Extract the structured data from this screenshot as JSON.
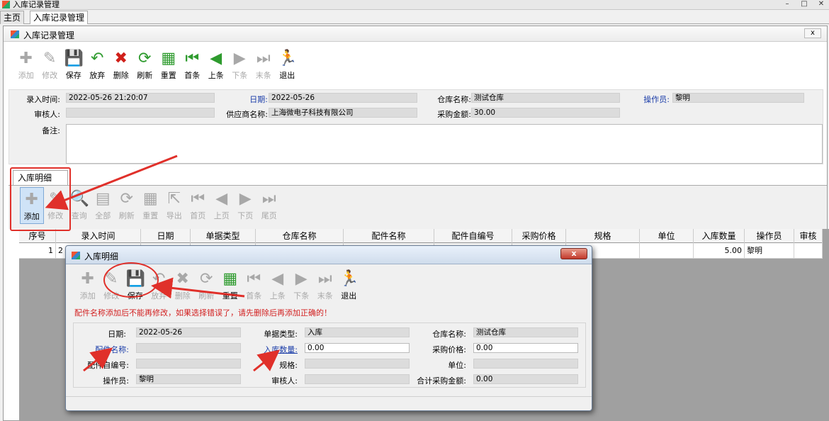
{
  "window": {
    "title": "入库记录管理"
  },
  "top_tabs": [
    {
      "label": "主页"
    },
    {
      "label": "入库记录管理"
    }
  ],
  "inner": {
    "title": "入库记录管理",
    "close_label": "x"
  },
  "main_toolbar": [
    {
      "label": "添加",
      "icon": "plus-icon",
      "glyph": "✚",
      "color": "#a8a8a8",
      "enabled": false
    },
    {
      "label": "修改",
      "icon": "edit-icon",
      "glyph": "✎",
      "color": "#a8a8a8",
      "enabled": false
    },
    {
      "label": "保存",
      "icon": "save-icon",
      "glyph": "💾",
      "color": "#1f5fbf",
      "enabled": true
    },
    {
      "label": "放弃",
      "icon": "undo-icon",
      "glyph": "↶",
      "color": "#2e9b2e",
      "enabled": true
    },
    {
      "label": "删除",
      "icon": "delete-icon",
      "glyph": "✖",
      "color": "#d0201a",
      "enabled": true
    },
    {
      "label": "刷新",
      "icon": "refresh-icon",
      "glyph": "⟳",
      "color": "#2e9b2e",
      "enabled": true
    },
    {
      "label": "重置",
      "icon": "reset-icon",
      "glyph": "▦",
      "color": "#2e9b2e",
      "enabled": true
    },
    {
      "label": "首条",
      "icon": "first-icon",
      "glyph": "⏮",
      "color": "#2e9b2e",
      "enabled": true
    },
    {
      "label": "上条",
      "icon": "prev-icon",
      "glyph": "◀",
      "color": "#2e9b2e",
      "enabled": true
    },
    {
      "label": "下条",
      "icon": "next-icon",
      "glyph": "▶",
      "color": "#a8a8a8",
      "enabled": false
    },
    {
      "label": "末条",
      "icon": "last-icon",
      "glyph": "⏭",
      "color": "#a8a8a8",
      "enabled": false
    },
    {
      "label": "退出",
      "icon": "exit-icon",
      "glyph": "🏃",
      "color": "#1f5fbf",
      "enabled": true
    }
  ],
  "form": {
    "entry_time_label": "录入时间:",
    "entry_time_value": "2022-05-26 21:20:07",
    "date_label": "日期:",
    "date_value": "2022-05-26",
    "warehouse_label": "仓库名称:",
    "warehouse_value": "测试仓库",
    "operator_label": "操作员:",
    "operator_value": "黎明",
    "auditor_label": "审核人:",
    "auditor_value": "",
    "supplier_label": "供应商名称:",
    "supplier_value": "上海微电子科技有限公司",
    "purchase_amount_label": "采购金额:",
    "purchase_amount_value": "30.00",
    "remark_label": "备注:",
    "remark_value": ""
  },
  "detail_tab": {
    "label": "入库明细"
  },
  "detail_toolbar": [
    {
      "label": "添加",
      "icon": "plus-icon",
      "glyph": "✚",
      "color": "#a8a8a8",
      "enabled": true,
      "highlight": true
    },
    {
      "label": "修改",
      "icon": "edit-icon",
      "glyph": "✎",
      "color": "#a8a8a8",
      "enabled": false
    },
    {
      "label": "查询",
      "icon": "search-icon",
      "glyph": "🔍",
      "color": "#a8a8a8",
      "enabled": false
    },
    {
      "label": "全部",
      "icon": "all-icon",
      "glyph": "▤",
      "color": "#a8a8a8",
      "enabled": false
    },
    {
      "label": "刷新",
      "icon": "refresh-icon",
      "glyph": "⟳",
      "color": "#a8a8a8",
      "enabled": false
    },
    {
      "label": "重置",
      "icon": "reset-icon",
      "glyph": "▦",
      "color": "#a8a8a8",
      "enabled": false
    },
    {
      "label": "导出",
      "icon": "export-icon",
      "glyph": "⇱",
      "color": "#a8a8a8",
      "enabled": false
    },
    {
      "label": "首页",
      "icon": "first-icon",
      "glyph": "⏮",
      "color": "#a8a8a8",
      "enabled": false
    },
    {
      "label": "上页",
      "icon": "prev-icon",
      "glyph": "◀",
      "color": "#a8a8a8",
      "enabled": false
    },
    {
      "label": "下页",
      "icon": "next-icon",
      "glyph": "▶",
      "color": "#a8a8a8",
      "enabled": false
    },
    {
      "label": "尾页",
      "icon": "last-icon",
      "glyph": "⏭",
      "color": "#a8a8a8",
      "enabled": false
    }
  ],
  "grid": {
    "columns": [
      "序号",
      "录入时间",
      "日期",
      "单据类型",
      "仓库名称",
      "配件名称",
      "配件自编号",
      "采购价格",
      "规格",
      "单位",
      "入库数量",
      "操作员",
      "审核"
    ],
    "rows": [
      [
        "1",
        "2",
        "",
        "",
        "",
        "",
        "",
        "",
        "",
        "",
        "5.00",
        "黎明",
        ""
      ]
    ]
  },
  "dialog": {
    "title": "入库明细",
    "close_label": "x",
    "warning": "配件名称添加后不能再修改，如果选择错误了，请先删除后再添加正确的！",
    "toolbar": [
      {
        "label": "添加",
        "icon": "plus-icon",
        "glyph": "✚",
        "color": "#a8a8a8",
        "enabled": false
      },
      {
        "label": "修改",
        "icon": "edit-icon",
        "glyph": "✎",
        "color": "#a8a8a8",
        "enabled": false
      },
      {
        "label": "保存",
        "icon": "save-icon",
        "glyph": "💾",
        "color": "#1f5fbf",
        "enabled": true
      },
      {
        "label": "放弃",
        "icon": "undo-icon",
        "glyph": "↶",
        "color": "#a8a8a8",
        "enabled": false
      },
      {
        "label": "删除",
        "icon": "delete-icon",
        "glyph": "✖",
        "color": "#a8a8a8",
        "enabled": false
      },
      {
        "label": "刷新",
        "icon": "refresh-icon",
        "glyph": "⟳",
        "color": "#a8a8a8",
        "enabled": false
      },
      {
        "label": "重置",
        "icon": "reset-icon",
        "glyph": "▦",
        "color": "#2e9b2e",
        "enabled": true
      },
      {
        "label": "首条",
        "icon": "first-icon",
        "glyph": "⏮",
        "color": "#a8a8a8",
        "enabled": false
      },
      {
        "label": "上条",
        "icon": "prev-icon",
        "glyph": "◀",
        "color": "#a8a8a8",
        "enabled": false
      },
      {
        "label": "下条",
        "icon": "next-icon",
        "glyph": "▶",
        "color": "#a8a8a8",
        "enabled": false
      },
      {
        "label": "末条",
        "icon": "last-icon",
        "glyph": "⏭",
        "color": "#a8a8a8",
        "enabled": false
      },
      {
        "label": "退出",
        "icon": "exit-icon",
        "glyph": "🏃",
        "color": "#1f5fbf",
        "enabled": true
      }
    ],
    "form": {
      "date_label": "日期:",
      "date_value": "2022-05-26",
      "doc_type_label": "单据类型:",
      "doc_type_value": "入库",
      "warehouse_label": "仓库名称:",
      "warehouse_value": "测试仓库",
      "part_name_label": "配件名称:",
      "part_name_value": "",
      "qty_label": "入库数量:",
      "qty_value": "0.00",
      "price_label": "采购价格:",
      "price_value": "0.00",
      "part_code_label": "配件自编号:",
      "part_code_value": "",
      "spec_label": "规格:",
      "spec_value": "",
      "unit_label": "单位:",
      "unit_value": "",
      "operator_label": "操作员:",
      "operator_value": "黎明",
      "auditor_label": "审核人:",
      "auditor_value": "",
      "total_label": "合计采购金额:",
      "total_value": "0.00"
    }
  },
  "colors": {
    "annotation_red": "#e0302a",
    "label_blue": "#1a3ca8",
    "warning_red": "#d21f1f"
  }
}
